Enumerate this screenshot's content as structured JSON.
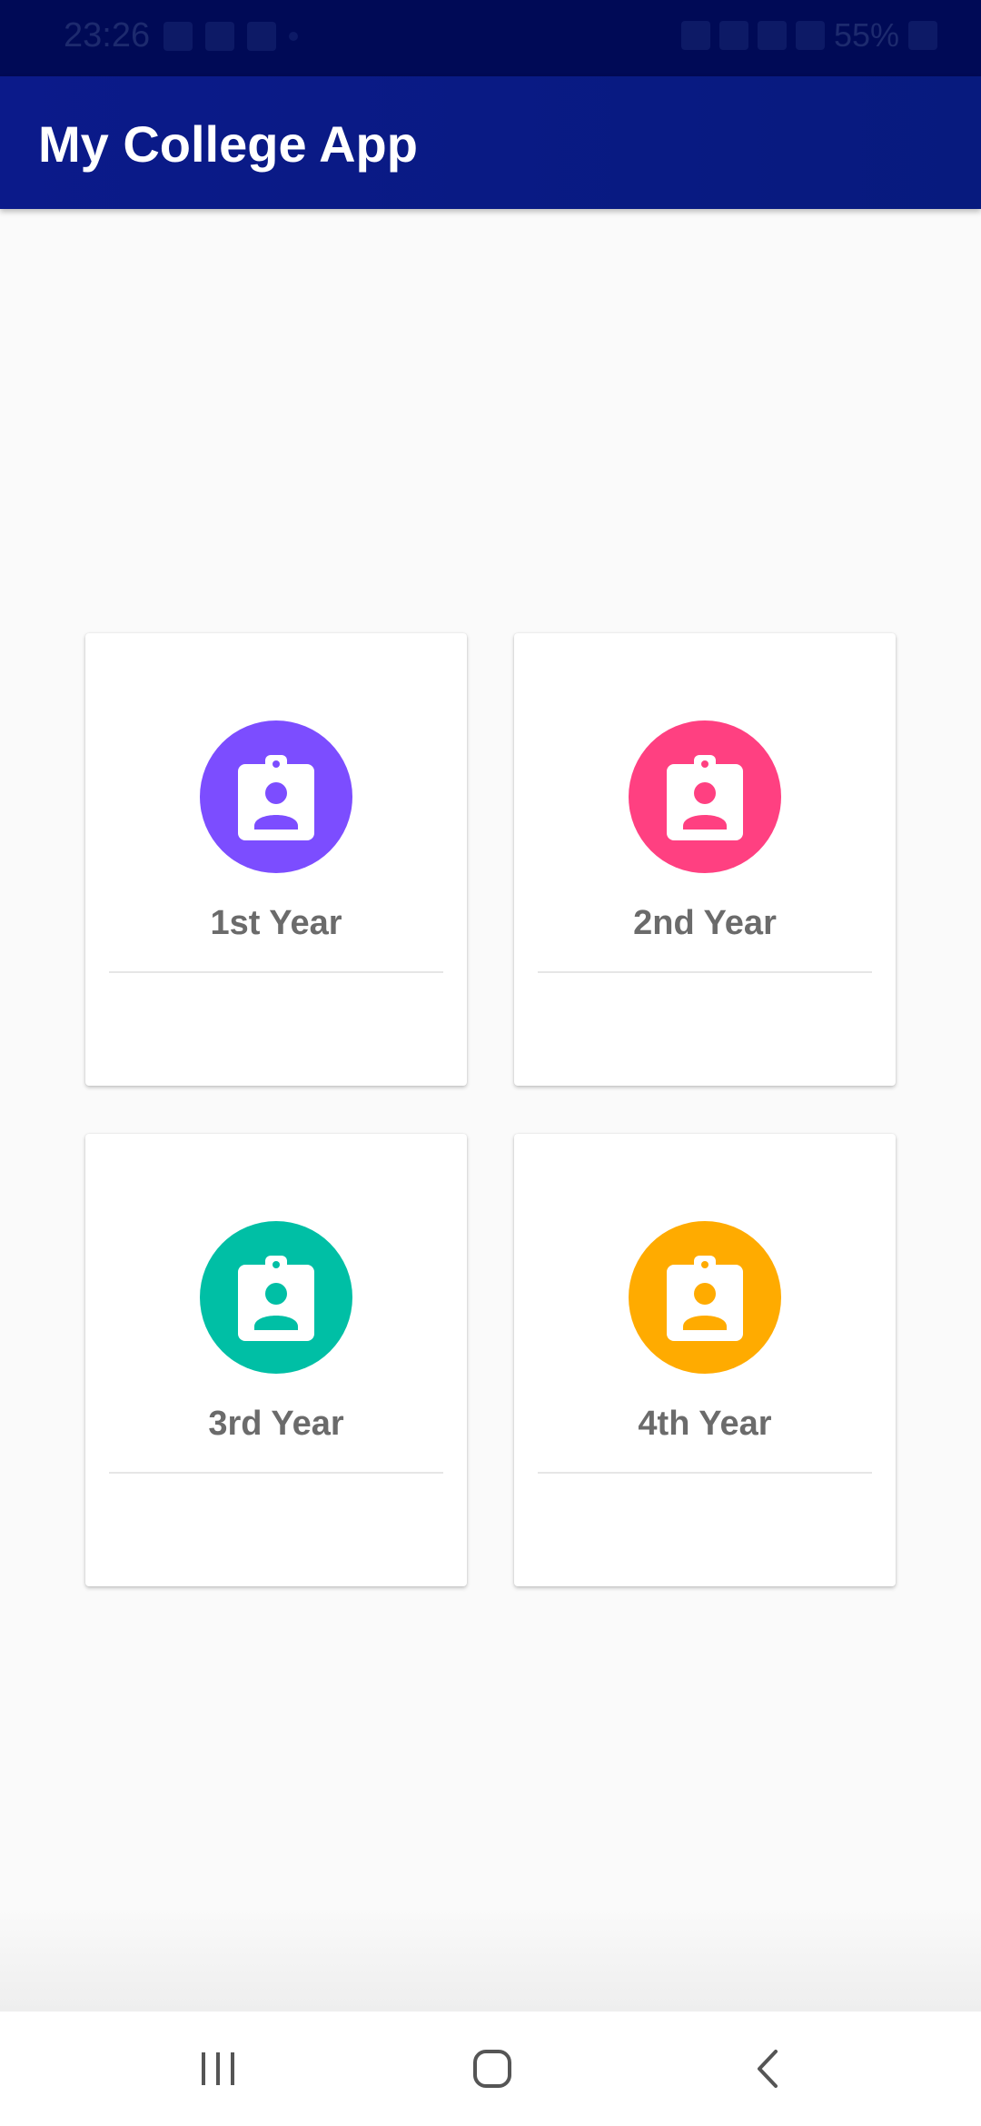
{
  "status_bar": {
    "time": "23:26",
    "battery": "55%"
  },
  "app_bar": {
    "title": "My College App"
  },
  "cards": [
    {
      "label": "1st Year",
      "icon": "contact-badge-icon",
      "color": "#7c4dff"
    },
    {
      "label": "2nd Year",
      "icon": "contact-badge-icon",
      "color": "#ff4081"
    },
    {
      "label": "3rd Year",
      "icon": "contact-badge-icon",
      "color": "#00bfa5"
    },
    {
      "label": "4th Year",
      "icon": "contact-badge-icon",
      "color": "#ffab00"
    }
  ],
  "nav": {
    "recent_icon": "recent-apps-icon",
    "home_icon": "home-icon",
    "back_icon": "back-icon"
  }
}
